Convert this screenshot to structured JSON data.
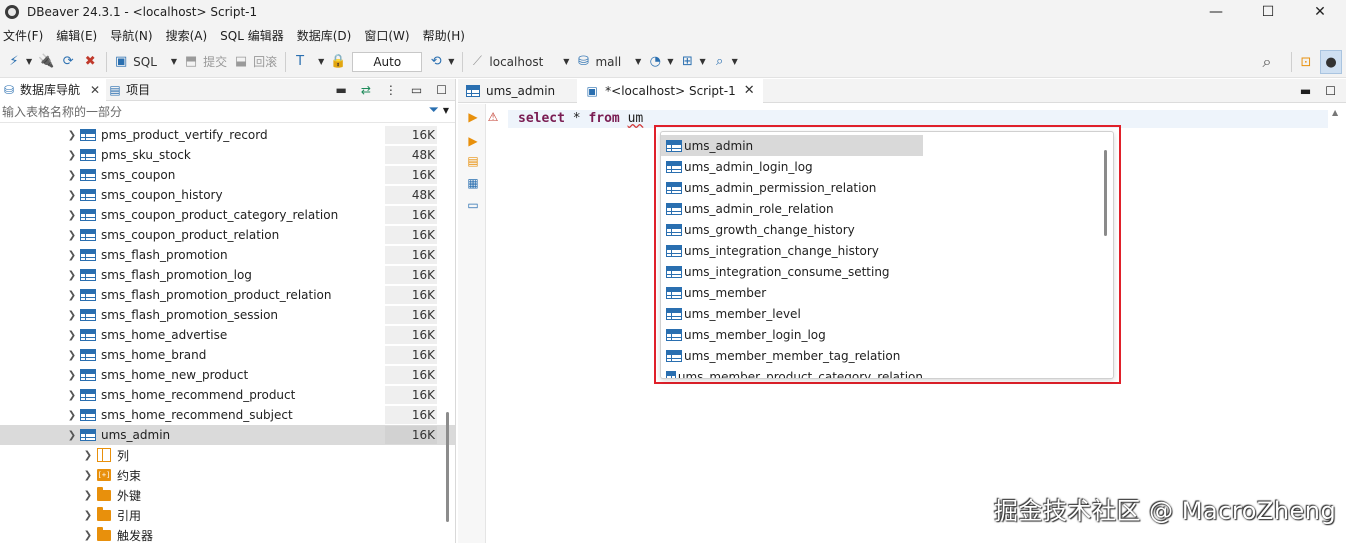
{
  "window": {
    "title": "DBeaver 24.3.1 - <localhost> Script-1",
    "controls": {
      "minimize": "—",
      "maximize": "☐",
      "close": "✕"
    }
  },
  "menu": [
    "文件(F)",
    "编辑(E)",
    "导航(N)",
    "搜索(A)",
    "SQL 编辑器",
    "数据库(D)",
    "窗口(W)",
    "帮助(H)"
  ],
  "toolbar": {
    "sql_label": "SQL",
    "commit_label": "提交",
    "rollback_label": "回滚",
    "transaction_mode": "Auto",
    "connection": "localhost",
    "database": "mall"
  },
  "left_panel": {
    "tab_navigator": "数据库导航",
    "tab_project": "项目",
    "filter_placeholder": "输入表格名称的一部分",
    "tables": [
      {
        "name": "pms_product_vertify_record",
        "size": "16K"
      },
      {
        "name": "pms_sku_stock",
        "size": "48K"
      },
      {
        "name": "sms_coupon",
        "size": "16K"
      },
      {
        "name": "sms_coupon_history",
        "size": "48K"
      },
      {
        "name": "sms_coupon_product_category_relation",
        "size": "16K"
      },
      {
        "name": "sms_coupon_product_relation",
        "size": "16K"
      },
      {
        "name": "sms_flash_promotion",
        "size": "16K"
      },
      {
        "name": "sms_flash_promotion_log",
        "size": "16K"
      },
      {
        "name": "sms_flash_promotion_product_relation",
        "size": "16K"
      },
      {
        "name": "sms_flash_promotion_session",
        "size": "16K"
      },
      {
        "name": "sms_home_advertise",
        "size": "16K"
      },
      {
        "name": "sms_home_brand",
        "size": "16K"
      },
      {
        "name": "sms_home_new_product",
        "size": "16K"
      },
      {
        "name": "sms_home_recommend_product",
        "size": "16K"
      },
      {
        "name": "sms_home_recommend_subject",
        "size": "16K"
      }
    ],
    "selected_table": {
      "name": "ums_admin",
      "size": "16K"
    },
    "children": [
      {
        "label": "列",
        "icon": "columns-icon"
      },
      {
        "label": "约束",
        "icon": "constraints-icon"
      },
      {
        "label": "外键",
        "icon": "folder-icon"
      },
      {
        "label": "引用",
        "icon": "folder-icon"
      },
      {
        "label": "触发器",
        "icon": "folder-icon"
      }
    ]
  },
  "editor": {
    "tabs": [
      {
        "label": "ums_admin",
        "active": false
      },
      {
        "label": "*<localhost> Script-1",
        "active": true
      }
    ],
    "code": {
      "kw1": "select",
      "star": "*",
      "kw2": "from",
      "partial": "um"
    }
  },
  "autocomplete": {
    "items": [
      "ums_admin",
      "ums_admin_login_log",
      "ums_admin_permission_relation",
      "ums_admin_role_relation",
      "ums_growth_change_history",
      "ums_integration_change_history",
      "ums_integration_consume_setting",
      "ums_member",
      "ums_member_level",
      "ums_member_login_log",
      "ums_member_member_tag_relation",
      "ums_member_product_category_relation"
    ],
    "selected_index": 0
  },
  "watermark": "掘金技术社区 @ MacroZheng",
  "colors": {
    "keyword": "#7a1c52",
    "highlight_outline": "#e0202a",
    "table_icon": "#2a6fb0",
    "folder": "#e8900c"
  }
}
